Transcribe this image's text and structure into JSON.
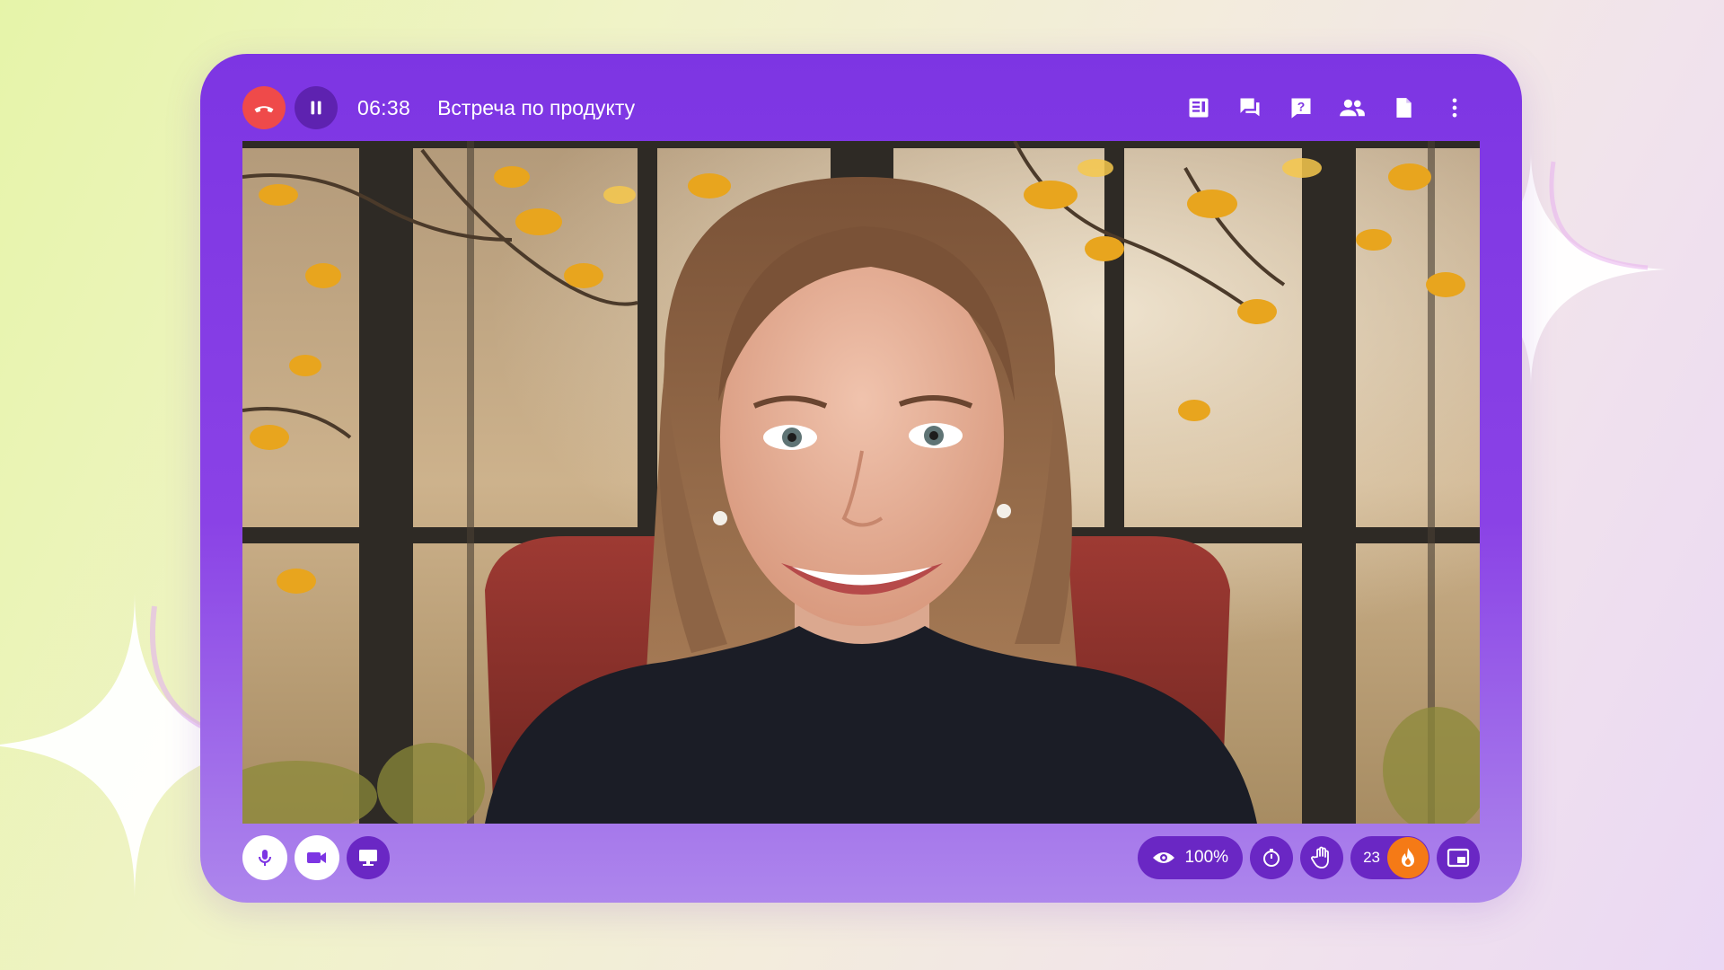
{
  "call": {
    "timer": "06:38",
    "title": "Встреча по продукту"
  },
  "viewers": {
    "percent": "100%"
  },
  "reactions": {
    "count": "23"
  },
  "colors": {
    "frame": "#7d35e3",
    "hangup": "#ef4a4a",
    "button_dark": "#6a27c4",
    "fire": "#f57a16"
  },
  "icons": {
    "top": [
      "agenda-icon",
      "chat-icon",
      "questions-icon",
      "participants-icon",
      "document-icon",
      "more-icon"
    ],
    "bottom_left": [
      "microphone-icon",
      "camera-icon",
      "screen-share-icon"
    ],
    "bottom_right": [
      "eye-icon",
      "timer-icon",
      "raise-hand-icon",
      "fire-icon",
      "picture-in-picture-icon"
    ]
  }
}
